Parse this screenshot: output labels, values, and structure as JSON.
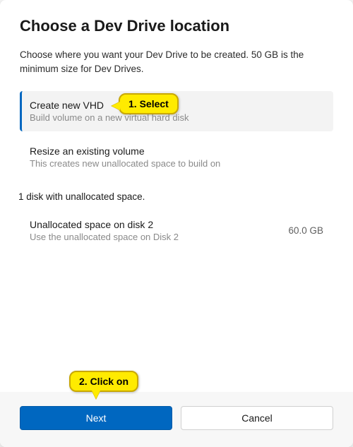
{
  "title": "Choose a Dev Drive location",
  "subtitle": "Choose where you want your Dev Drive to be created. 50 GB is the minimum size for Dev Drives.",
  "options": {
    "create_vhd": {
      "title": "Create new VHD",
      "desc": "Build volume on a new virtual hard disk"
    },
    "resize": {
      "title": "Resize an existing volume",
      "desc": "This creates new unallocated space to build on"
    }
  },
  "disk_section_label": "1 disk with unallocated space.",
  "disk": {
    "title": "Unallocated space on disk 2",
    "desc": "Use the unallocated space on Disk 2",
    "size": "60.0 GB"
  },
  "buttons": {
    "next": "Next",
    "cancel": "Cancel"
  },
  "annotations": {
    "select": "1. Select",
    "click": "2. Click on"
  }
}
